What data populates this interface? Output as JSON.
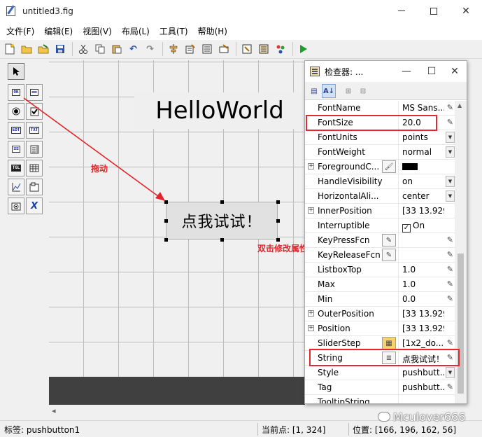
{
  "window": {
    "title": "untitled3.fig",
    "minimize": "—",
    "maximize": "☐",
    "close": "✕"
  },
  "menu": [
    "文件(F)",
    "编辑(E)",
    "视图(V)",
    "布局(L)",
    "工具(T)",
    "帮助(H)"
  ],
  "toolbar_icons": [
    "new-icon",
    "open-icon",
    "open-edit-icon",
    "save-icon",
    "cut-icon",
    "copy-icon",
    "paste-icon",
    "undo-icon",
    "redo-icon",
    "align-icon",
    "menu-editor-icon",
    "tab-order-icon",
    "toolbar-editor-icon",
    "editor-icon",
    "property-inspector-icon",
    "object-browser-icon",
    "run-icon"
  ],
  "palette": {
    "items": [
      "select",
      "pushbutton",
      "slider",
      "radiobutton",
      "checkbox",
      "edit",
      "text",
      "popupmenu",
      "listbox",
      "togglebutton",
      "table",
      "axes",
      "panel",
      "buttongroup",
      "activex"
    ],
    "labels": {
      "pushbutton": "OK",
      "slider": "▬▬",
      "edit": "EDT",
      "text": "TXT",
      "popup": "≡≡",
      "toggle": "TGL",
      "activex": "X"
    }
  },
  "canvas": {
    "static_text": "HelloWorld",
    "push_button": "点我试试！"
  },
  "annotations": {
    "drag": "拖动",
    "double_click": "双击修改属性"
  },
  "inspector": {
    "title": "检查器: ...",
    "minimize": "—",
    "maximize": "☐",
    "close": "✕",
    "properties": [
      {
        "name": "FontName",
        "value": "MS Sans...",
        "control": "pencil"
      },
      {
        "name": "FontSize",
        "value": "20.0",
        "control": "pencil"
      },
      {
        "name": "FontUnits",
        "value": "points",
        "control": "dropdown"
      },
      {
        "name": "FontWeight",
        "value": "normal",
        "control": "dropdown"
      },
      {
        "name": "ForegroundC...",
        "value": "",
        "control": "color",
        "expandable": true
      },
      {
        "name": "HandleVisibility",
        "value": "on",
        "control": "dropdown"
      },
      {
        "name": "HorizontalAli...",
        "value": "center",
        "control": "dropdown"
      },
      {
        "name": "InnerPosition",
        "value": "[33 13.929 ...",
        "control": "none",
        "expandable": true
      },
      {
        "name": "Interruptible",
        "value": "On",
        "control": "checkbox"
      },
      {
        "name": "KeyPressFcn",
        "value": "",
        "control": "pencil",
        "editor": true
      },
      {
        "name": "KeyReleaseFcn",
        "value": "",
        "control": "pencil",
        "editor": true
      },
      {
        "name": "ListboxTop",
        "value": "1.0",
        "control": "pencil"
      },
      {
        "name": "Max",
        "value": "1.0",
        "control": "pencil"
      },
      {
        "name": "Min",
        "value": "0.0",
        "control": "pencil"
      },
      {
        "name": "OuterPosition",
        "value": "[33 13.929 ...",
        "control": "none",
        "expandable": true
      },
      {
        "name": "Position",
        "value": "[33 13.929 ...",
        "control": "none",
        "expandable": true
      },
      {
        "name": "SliderStep",
        "value": "[1x2_do...",
        "control": "pencil",
        "grid": true
      },
      {
        "name": "String",
        "value": "点我试试！",
        "control": "pencil",
        "text_editor": true
      },
      {
        "name": "Style",
        "value": "pushbutt...",
        "control": "dropdown"
      },
      {
        "name": "Tag",
        "value": "pushbutt...",
        "control": "pencil"
      },
      {
        "name": "TooltipString",
        "value": "",
        "control": "none"
      }
    ]
  },
  "status": {
    "tag": "标签: pushbutton1",
    "current_point": "当前点:  [1, 324]",
    "position": "位置: [166, 196, 162, 56]"
  },
  "watermark": "Mculover666",
  "colors": {
    "highlight": "#e5282d",
    "annotation": "#e3262b",
    "run": "#1f9d2e"
  }
}
